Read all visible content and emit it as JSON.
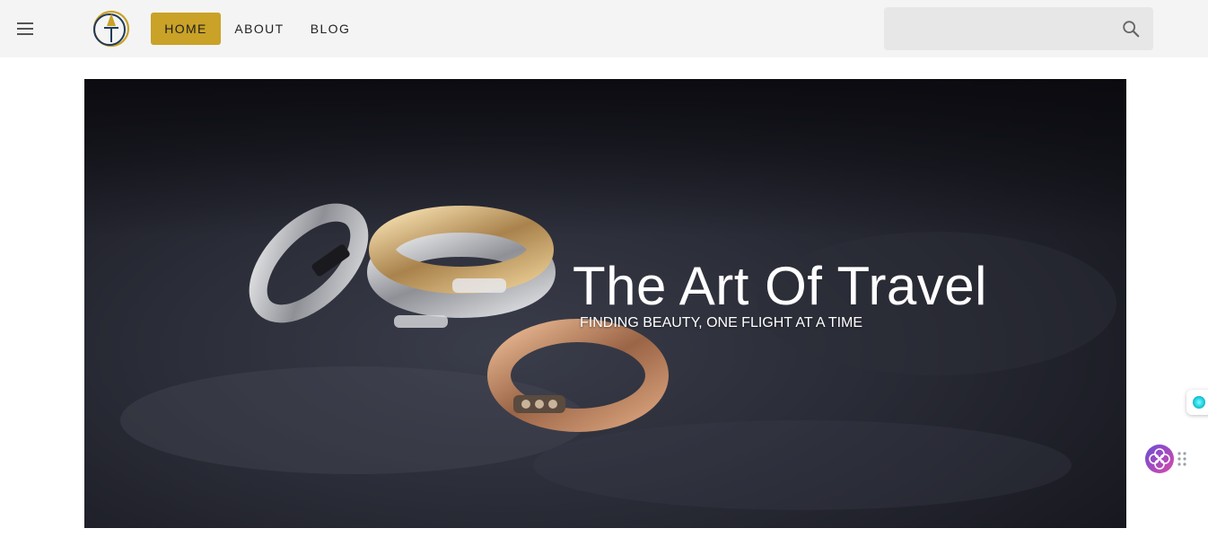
{
  "header": {
    "logo_label": "",
    "nav": [
      {
        "label": "HOME"
      },
      {
        "label": "ABOUT"
      },
      {
        "label": "BLOG"
      }
    ],
    "search": {
      "placeholder": "",
      "value": ""
    },
    "icons": [
      "menu-icon",
      "search-icon"
    ]
  },
  "hero": {
    "title": "The Art Of Travel",
    "subtitle": "FINDING BEAUTY, ONE FLIGHT AT A TIME"
  },
  "colors": {
    "accent": "#c9a227",
    "topbar": "#f4f4f4",
    "hero_bg": "#1b1c24"
  },
  "widgets": {
    "side_widget_icon": "cyan-orb-icon",
    "assistant_icon": "flower-assistant-icon",
    "grip_icon": "drag-grip-icon"
  }
}
